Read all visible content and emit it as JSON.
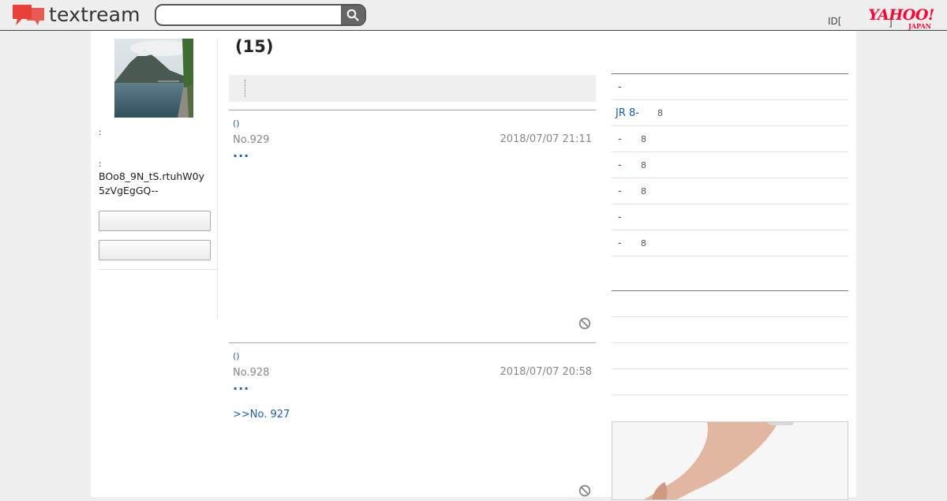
{
  "header": {
    "logo_text": "textream",
    "search": {
      "value": "",
      "placeholder": ""
    },
    "id_label": "ID[",
    "id_bracket": "]",
    "yahoo_main": "YAHOO!",
    "yahoo_sub": "JAPAN"
  },
  "sidebar": {
    "colon_1": ":",
    "colon_2": ":",
    "user_id": "BOo8_9N_tS.rtuhW0y5zVgEgGQ--",
    "button_1": "",
    "button_2": ""
  },
  "main": {
    "title": "(15)",
    "posts": [
      {
        "author": "()",
        "number": "No.929",
        "date": "2018/07/07 21:11",
        "more": "...",
        "reply": ""
      },
      {
        "author": "()",
        "number": "No.928",
        "date": "2018/07/07 20:58",
        "more": "...",
        "reply": ">>No. 927"
      }
    ]
  },
  "ranking": [
    {
      "label": "-",
      "count": ""
    },
    {
      "label": "JR 8-",
      "count": "8"
    },
    {
      "label": "-",
      "count": "8"
    },
    {
      "label": "-",
      "count": "8"
    },
    {
      "label": "-",
      "count": "8"
    },
    {
      "label": "-",
      "count": ""
    },
    {
      "label": "-",
      "count": "8"
    }
  ],
  "colors": {
    "link": "#1a5fa8",
    "brand_red": "#e8403a",
    "yahoo_red": "#ff0033"
  },
  "icons": [
    "textream-logo-icon",
    "search-icon",
    "report-icon"
  ]
}
